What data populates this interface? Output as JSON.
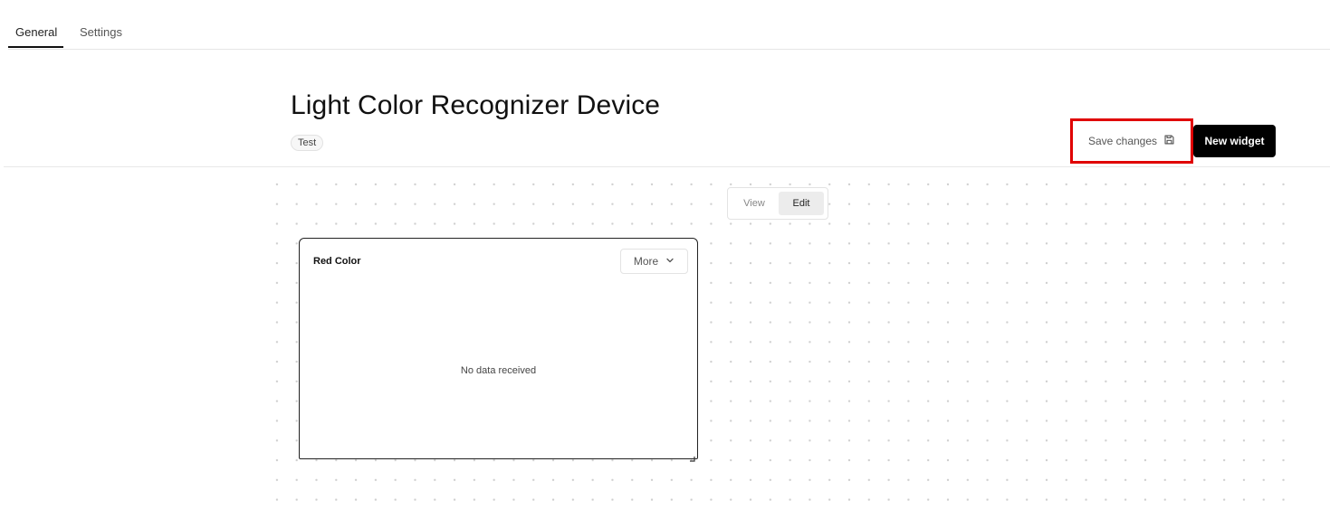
{
  "tabs": [
    {
      "label": "General",
      "active": true
    },
    {
      "label": "Settings",
      "active": false
    }
  ],
  "header": {
    "title": "Light Color Recognizer Device",
    "tag": "Test",
    "save_label": "Save changes",
    "save_icon": "floppy-disk-icon",
    "new_widget_label": "New widget"
  },
  "mode_toggle": {
    "view_label": "View",
    "edit_label": "Edit",
    "selected": "Edit"
  },
  "widgets": [
    {
      "title": "Red Color",
      "more_label": "More",
      "more_icon": "chevron-down-icon",
      "empty_message": "No data received"
    }
  ],
  "colors": {
    "highlight": "#e00000",
    "primary_button": "#000000",
    "active_toggle": "#ececec"
  }
}
